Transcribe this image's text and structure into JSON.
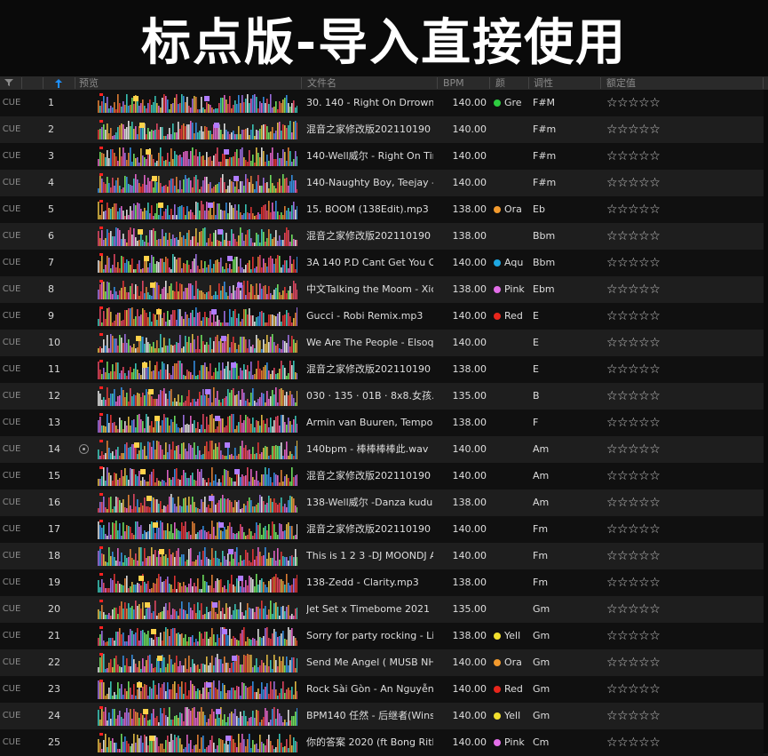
{
  "banner": {
    "title": "标点版-导入直接使用"
  },
  "header": {
    "filter_icon": "filter-icon",
    "sort_icon": "sort-arrow-up-icon",
    "preview": "预览",
    "filename": "文件名",
    "bpm": "BPM",
    "color": "颜",
    "key": "调性",
    "rating": "额定值"
  },
  "colors": {
    "Green": "#2ecc40",
    "Orange": "#f29a2e",
    "Aqua": "#1ea7e1",
    "Pink": "#e36ee8",
    "Red": "#e8261c",
    "Yellow": "#f2e02e"
  },
  "rows": [
    {
      "cue": "CUE",
      "num": "1",
      "file": "30. 140 - Right On Drrown x",
      "bpm": "140.00",
      "color": "Gre",
      "color_name": "Green",
      "key": "F#M",
      "stars": "☆☆☆☆☆"
    },
    {
      "cue": "CUE",
      "num": "2",
      "file": "混音之家修改版202110190",
      "bpm": "140.00",
      "color": "",
      "color_name": "",
      "key": "F#m",
      "stars": "☆☆☆☆☆"
    },
    {
      "cue": "CUE",
      "num": "3",
      "file": "140-Well威尔 - Right On Tim",
      "bpm": "140.00",
      "color": "",
      "color_name": "",
      "key": "F#m",
      "stars": "☆☆☆☆☆"
    },
    {
      "cue": "CUE",
      "num": "4",
      "file": "140-Naughty Boy, Teejay - La",
      "bpm": "140.00",
      "color": "",
      "color_name": "",
      "key": "F#m",
      "stars": "☆☆☆☆☆"
    },
    {
      "cue": "CUE",
      "num": "5",
      "file": "15. BOOM (138Edit).mp3",
      "bpm": "138.00",
      "color": "Ora",
      "color_name": "Orange",
      "key": "Eb",
      "stars": "☆☆☆☆☆"
    },
    {
      "cue": "CUE",
      "num": "6",
      "file": "混音之家修改版202110190",
      "bpm": "138.00",
      "color": "",
      "color_name": "",
      "key": "Bbm",
      "stars": "☆☆☆☆☆"
    },
    {
      "cue": "CUE",
      "num": "7",
      "file": "3A 140 P.D Cant Get You Ou",
      "bpm": "140.00",
      "color": "Aqu",
      "color_name": "Aqua",
      "key": "Bbm",
      "stars": "☆☆☆☆☆"
    },
    {
      "cue": "CUE",
      "num": "8",
      "file": "中文Talking the Moom - Xica",
      "bpm": "138.00",
      "color": "Pink",
      "color_name": "Pink",
      "key": "Ebm",
      "stars": "☆☆☆☆☆"
    },
    {
      "cue": "CUE",
      "num": "9",
      "file": "Gucci - Robi Remix.mp3",
      "bpm": "140.00",
      "color": "Red",
      "color_name": "Red",
      "key": "E",
      "stars": "☆☆☆☆☆"
    },
    {
      "cue": "CUE",
      "num": "10",
      "file": "We Are The People - Elsoq.m",
      "bpm": "140.00",
      "color": "",
      "color_name": "",
      "key": "E",
      "stars": "☆☆☆☆☆"
    },
    {
      "cue": "CUE",
      "num": "11",
      "file": "混音之家修改版202110190",
      "bpm": "138.00",
      "color": "",
      "color_name": "",
      "key": "E",
      "stars": "☆☆☆☆☆"
    },
    {
      "cue": "CUE",
      "num": "12",
      "file": "030 · 135 · 01B · 8x8.女孩.W",
      "bpm": "135.00",
      "color": "",
      "color_name": "",
      "key": "B",
      "stars": "☆☆☆☆☆"
    },
    {
      "cue": "CUE",
      "num": "13",
      "file": "Armin van Buuren, Tempo Gi",
      "bpm": "138.00",
      "color": "",
      "color_name": "",
      "key": "F",
      "stars": "☆☆☆☆☆"
    },
    {
      "cue": "CUE",
      "num": "14",
      "file": "140bpm - 棒棒棒棒此.wav",
      "bpm": "140.00",
      "color": "",
      "color_name": "",
      "key": "Am",
      "stars": "☆☆☆☆☆",
      "playing": true
    },
    {
      "cue": "CUE",
      "num": "15",
      "file": "混音之家修改版202110190",
      "bpm": "140.00",
      "color": "",
      "color_name": "",
      "key": "Am",
      "stars": "☆☆☆☆☆"
    },
    {
      "cue": "CUE",
      "num": "16",
      "file": "138-Well威尔 -Danza kuduro.",
      "bpm": "138.00",
      "color": "",
      "color_name": "",
      "key": "Am",
      "stars": "☆☆☆☆☆"
    },
    {
      "cue": "CUE",
      "num": "17",
      "file": "混音之家修改版202110190",
      "bpm": "140.00",
      "color": "",
      "color_name": "",
      "key": "Fm",
      "stars": "☆☆☆☆☆"
    },
    {
      "cue": "CUE",
      "num": "18",
      "file": "This is 1 2 3 -DJ MOONDJ A",
      "bpm": "140.00",
      "color": "",
      "color_name": "",
      "key": "Fm",
      "stars": "☆☆☆☆☆"
    },
    {
      "cue": "CUE",
      "num": "19",
      "file": "138-Zedd - Clarity.mp3",
      "bpm": "138.00",
      "color": "",
      "color_name": "",
      "key": "Fm",
      "stars": "☆☆☆☆☆"
    },
    {
      "cue": "CUE",
      "num": "20",
      "file": "Jet Set x Timebome 2021 HD",
      "bpm": "135.00",
      "color": "",
      "color_name": "",
      "key": "Gm",
      "stars": "☆☆☆☆☆"
    },
    {
      "cue": "CUE",
      "num": "21",
      "file": "Sorry for party rocking - Linh",
      "bpm": "138.00",
      "color": "Yell",
      "color_name": "Yellow",
      "key": "Gm",
      "stars": "☆☆☆☆☆"
    },
    {
      "cue": "CUE",
      "num": "22",
      "file": "Send Me Angel ( MUSB NHO",
      "bpm": "140.00",
      "color": "Ora",
      "color_name": "Orange",
      "key": "Gm",
      "stars": "☆☆☆☆☆"
    },
    {
      "cue": "CUE",
      "num": "23",
      "file": "Rock Sài Gòn - An Nguyễn R",
      "bpm": "140.00",
      "color": "Red",
      "color_name": "Red",
      "key": "Gm",
      "stars": "☆☆☆☆☆"
    },
    {
      "cue": "CUE",
      "num": "24",
      "file": "BPM140 任然 - 后继者(Wins",
      "bpm": "140.00",
      "color": "Yell",
      "color_name": "Yellow",
      "key": "Gm",
      "stars": "☆☆☆☆☆"
    },
    {
      "cue": "CUE",
      "num": "25",
      "file": "你的答案 2020 (ft Bong Rith",
      "bpm": "140.00",
      "color": "Pink",
      "color_name": "Pink",
      "key": "Cm",
      "stars": "☆☆☆☆☆"
    }
  ]
}
